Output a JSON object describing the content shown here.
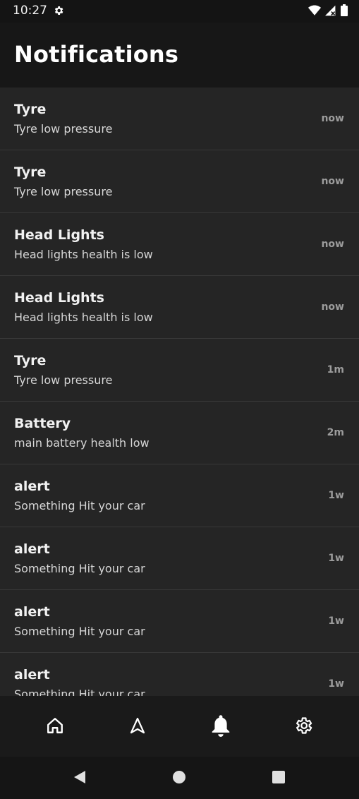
{
  "status_bar": {
    "time": "10:27",
    "icons": [
      "settings-gear-icon",
      "wifi-icon",
      "signal-no-data-icon",
      "battery-icon"
    ]
  },
  "header": {
    "title": "Notifications"
  },
  "notifications": [
    {
      "title": "Tyre",
      "body": "Tyre low pressure",
      "time": "now"
    },
    {
      "title": "Tyre",
      "body": "Tyre low pressure",
      "time": "now"
    },
    {
      "title": "Head Lights",
      "body": "Head lights health is low",
      "time": "now"
    },
    {
      "title": "Head Lights",
      "body": "Head lights health is low",
      "time": "now"
    },
    {
      "title": "Tyre",
      "body": "Tyre low pressure",
      "time": "1m"
    },
    {
      "title": "Battery",
      "body": "main battery health low",
      "time": "2m"
    },
    {
      "title": "alert",
      "body": "Something Hit your car",
      "time": "1w"
    },
    {
      "title": "alert",
      "body": "Something Hit your car",
      "time": "1w"
    },
    {
      "title": "alert",
      "body": "Something Hit your car",
      "time": "1w"
    },
    {
      "title": "alert",
      "body": "Something Hit your car",
      "time": "1w"
    }
  ],
  "bottom_nav": {
    "items": [
      "home-icon",
      "navigation-arrow-icon",
      "bell-icon",
      "settings-gear-icon"
    ],
    "active": "bell-icon"
  },
  "system_nav": [
    "back-triangle-icon",
    "home-circle-icon",
    "recents-square-icon"
  ]
}
